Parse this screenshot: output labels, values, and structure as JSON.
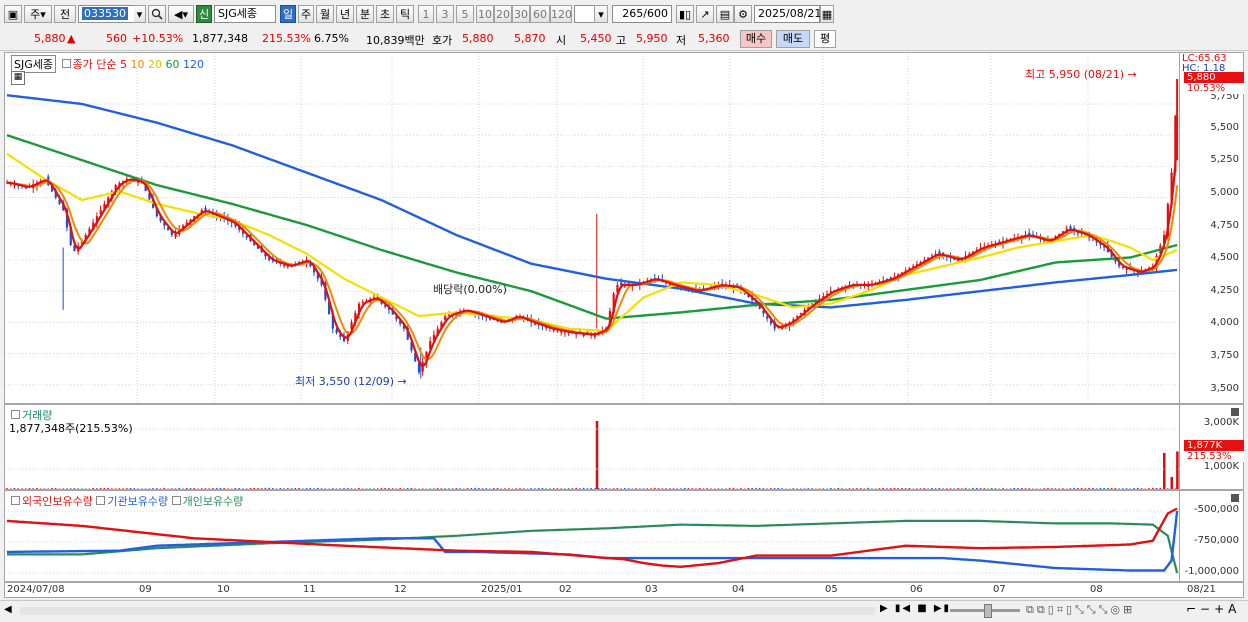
{
  "toolbar": {
    "jong": "주",
    "jeon": "전",
    "code": "033530",
    "sin": "신",
    "name": "SJG세종",
    "periods": [
      "일",
      "주",
      "월",
      "년",
      "분",
      "초",
      "틱"
    ],
    "active_period": "일",
    "minutes": [
      "1",
      "3",
      "5",
      "10",
      "20",
      "30",
      "60",
      "120"
    ],
    "count": "265",
    "count_total": "/600",
    "date": "2025/08/21"
  },
  "quote": {
    "price": "5,880",
    "up_arrow": "▲",
    "change": "560",
    "change_pct": "+10.53%",
    "volume": "1,877,348",
    "volume_pct": "215.53%",
    "turnover": "6.75%",
    "amount": "10,839백만",
    "ho_label": "호가",
    "ask": "5,880",
    "bid": "5,870",
    "open_label": "시",
    "open": "5,450",
    "high_label": "고",
    "high": "5,950",
    "low_label": "저",
    "low": "5,360",
    "buy": "매수",
    "sell": "매도",
    "avg": "평"
  },
  "price_pane": {
    "ticker": "SJG세종",
    "legend_prefix": "종가 단순",
    "ma_labels": [
      "5",
      "10",
      "20",
      "60",
      "120"
    ],
    "ma_colors": [
      "#e01010",
      "#f08a00",
      "#f4e000",
      "#1a9a3a",
      "#2060e0"
    ],
    "lc": "LC:65.63",
    "hc": "HC: 1.18",
    "tag_price": "5,880",
    "tag_pct": "10.53%",
    "y_ticks": [
      "5,750",
      "5,500",
      "5,250",
      "5,000",
      "4,750",
      "4,500",
      "4,250",
      "4,000",
      "3,750",
      "3,500"
    ],
    "high_note": "최고 5,950 (08/21)",
    "low_note": "최저 3,550 (12/09)",
    "dividend_note": "배당락(0.00%)"
  },
  "volume_pane": {
    "title": "거래량",
    "value": "1,877,348주(215.53%)",
    "tag_value": "1,877K",
    "tag_pct": "215.53%",
    "y_ticks": [
      "3,000K",
      "1,000K"
    ]
  },
  "holdings_pane": {
    "labels": [
      "외국인보유수량",
      "기관보유수량",
      "개인보유수량"
    ],
    "colors": [
      "#e01010",
      "#2060e0",
      "#2a8a5a"
    ],
    "y_ticks": [
      "-500,000",
      "-750,000",
      "-1,000,000"
    ]
  },
  "x_axis": [
    "2024/07/08",
    "09",
    "10",
    "11",
    "12",
    "2025/01",
    "02",
    "03",
    "04",
    "05",
    "06",
    "07",
    "08",
    "08/21"
  ],
  "chart_data": {
    "type": "candlestick",
    "x_range": [
      "2024/07/08",
      "2025/08/21"
    ],
    "ylim": [
      3450,
      5950
    ],
    "close_points": [
      [
        0,
        5120
      ],
      [
        10,
        5080
      ],
      [
        20,
        5150
      ],
      [
        30,
        4900
      ],
      [
        35,
        4550
      ],
      [
        42,
        4700
      ],
      [
        50,
        4900
      ],
      [
        58,
        5100
      ],
      [
        64,
        5150
      ],
      [
        72,
        5120
      ],
      [
        80,
        4850
      ],
      [
        88,
        4700
      ],
      [
        96,
        4800
      ],
      [
        104,
        4900
      ],
      [
        112,
        4850
      ],
      [
        120,
        4800
      ],
      [
        130,
        4650
      ],
      [
        140,
        4500
      ],
      [
        150,
        4450
      ],
      [
        160,
        4500
      ],
      [
        168,
        4300
      ],
      [
        174,
        3950
      ],
      [
        180,
        3850
      ],
      [
        188,
        4150
      ],
      [
        196,
        4200
      ],
      [
        204,
        4100
      ],
      [
        212,
        3950
      ],
      [
        220,
        3600
      ],
      [
        226,
        3850
      ],
      [
        234,
        4050
      ],
      [
        244,
        4100
      ],
      [
        254,
        4050
      ],
      [
        264,
        4000
      ],
      [
        272,
        4050
      ],
      [
        280,
        4000
      ],
      [
        290,
        3950
      ],
      [
        300,
        3920
      ],
      [
        312,
        3900
      ],
      [
        320,
        3950
      ],
      [
        325,
        4300
      ],
      [
        335,
        4300
      ],
      [
        345,
        4350
      ],
      [
        355,
        4300
      ],
      [
        368,
        4250
      ],
      [
        380,
        4300
      ],
      [
        390,
        4280
      ],
      [
        400,
        4150
      ],
      [
        410,
        3950
      ],
      [
        418,
        4000
      ],
      [
        430,
        4150
      ],
      [
        440,
        4250
      ],
      [
        450,
        4300
      ],
      [
        460,
        4300
      ],
      [
        472,
        4350
      ],
      [
        484,
        4450
      ],
      [
        496,
        4550
      ],
      [
        508,
        4500
      ],
      [
        520,
        4600
      ],
      [
        532,
        4650
      ],
      [
        544,
        4700
      ],
      [
        556,
        4650
      ],
      [
        566,
        4750
      ],
      [
        576,
        4700
      ],
      [
        586,
        4600
      ],
      [
        594,
        4450
      ],
      [
        604,
        4400
      ],
      [
        612,
        4450
      ],
      [
        618,
        4700
      ],
      [
        622,
        5200
      ],
      [
        625,
        5880
      ]
    ],
    "ma20": [
      [
        0,
        5350
      ],
      [
        20,
        5150
      ],
      [
        40,
        4980
      ],
      [
        60,
        5050
      ],
      [
        80,
        4950
      ],
      [
        100,
        4880
      ],
      [
        120,
        4820
      ],
      [
        140,
        4700
      ],
      [
        160,
        4550
      ],
      [
        180,
        4350
      ],
      [
        200,
        4200
      ],
      [
        220,
        4050
      ],
      [
        240,
        4080
      ],
      [
        260,
        4050
      ],
      [
        280,
        4020
      ],
      [
        300,
        3950
      ],
      [
        320,
        3930
      ],
      [
        340,
        4200
      ],
      [
        360,
        4320
      ],
      [
        380,
        4300
      ],
      [
        400,
        4220
      ],
      [
        420,
        4120
      ],
      [
        440,
        4150
      ],
      [
        460,
        4250
      ],
      [
        480,
        4380
      ],
      [
        500,
        4450
      ],
      [
        520,
        4520
      ],
      [
        540,
        4600
      ],
      [
        560,
        4650
      ],
      [
        580,
        4700
      ],
      [
        600,
        4600
      ],
      [
        612,
        4500
      ],
      [
        625,
        4580
      ]
    ],
    "ma60": [
      [
        0,
        5500
      ],
      [
        40,
        5300
      ],
      [
        80,
        5100
      ],
      [
        120,
        4950
      ],
      [
        160,
        4780
      ],
      [
        200,
        4580
      ],
      [
        240,
        4400
      ],
      [
        280,
        4250
      ],
      [
        320,
        4030
      ],
      [
        360,
        4080
      ],
      [
        400,
        4140
      ],
      [
        440,
        4180
      ],
      [
        480,
        4260
      ],
      [
        520,
        4340
      ],
      [
        560,
        4480
      ],
      [
        600,
        4520
      ],
      [
        625,
        4620
      ]
    ],
    "ma120": [
      [
        0,
        5820
      ],
      [
        40,
        5750
      ],
      [
        80,
        5600
      ],
      [
        120,
        5420
      ],
      [
        160,
        5200
      ],
      [
        200,
        4980
      ],
      [
        240,
        4700
      ],
      [
        280,
        4470
      ],
      [
        320,
        4350
      ],
      [
        360,
        4270
      ],
      [
        400,
        4150
      ],
      [
        440,
        4120
      ],
      [
        480,
        4180
      ],
      [
        520,
        4250
      ],
      [
        560,
        4320
      ],
      [
        600,
        4380
      ],
      [
        625,
        4420
      ]
    ],
    "volume_spikes": [
      [
        315,
        3400
      ],
      [
        618,
        1800
      ],
      [
        622,
        600
      ],
      [
        625,
        1877
      ]
    ]
  }
}
